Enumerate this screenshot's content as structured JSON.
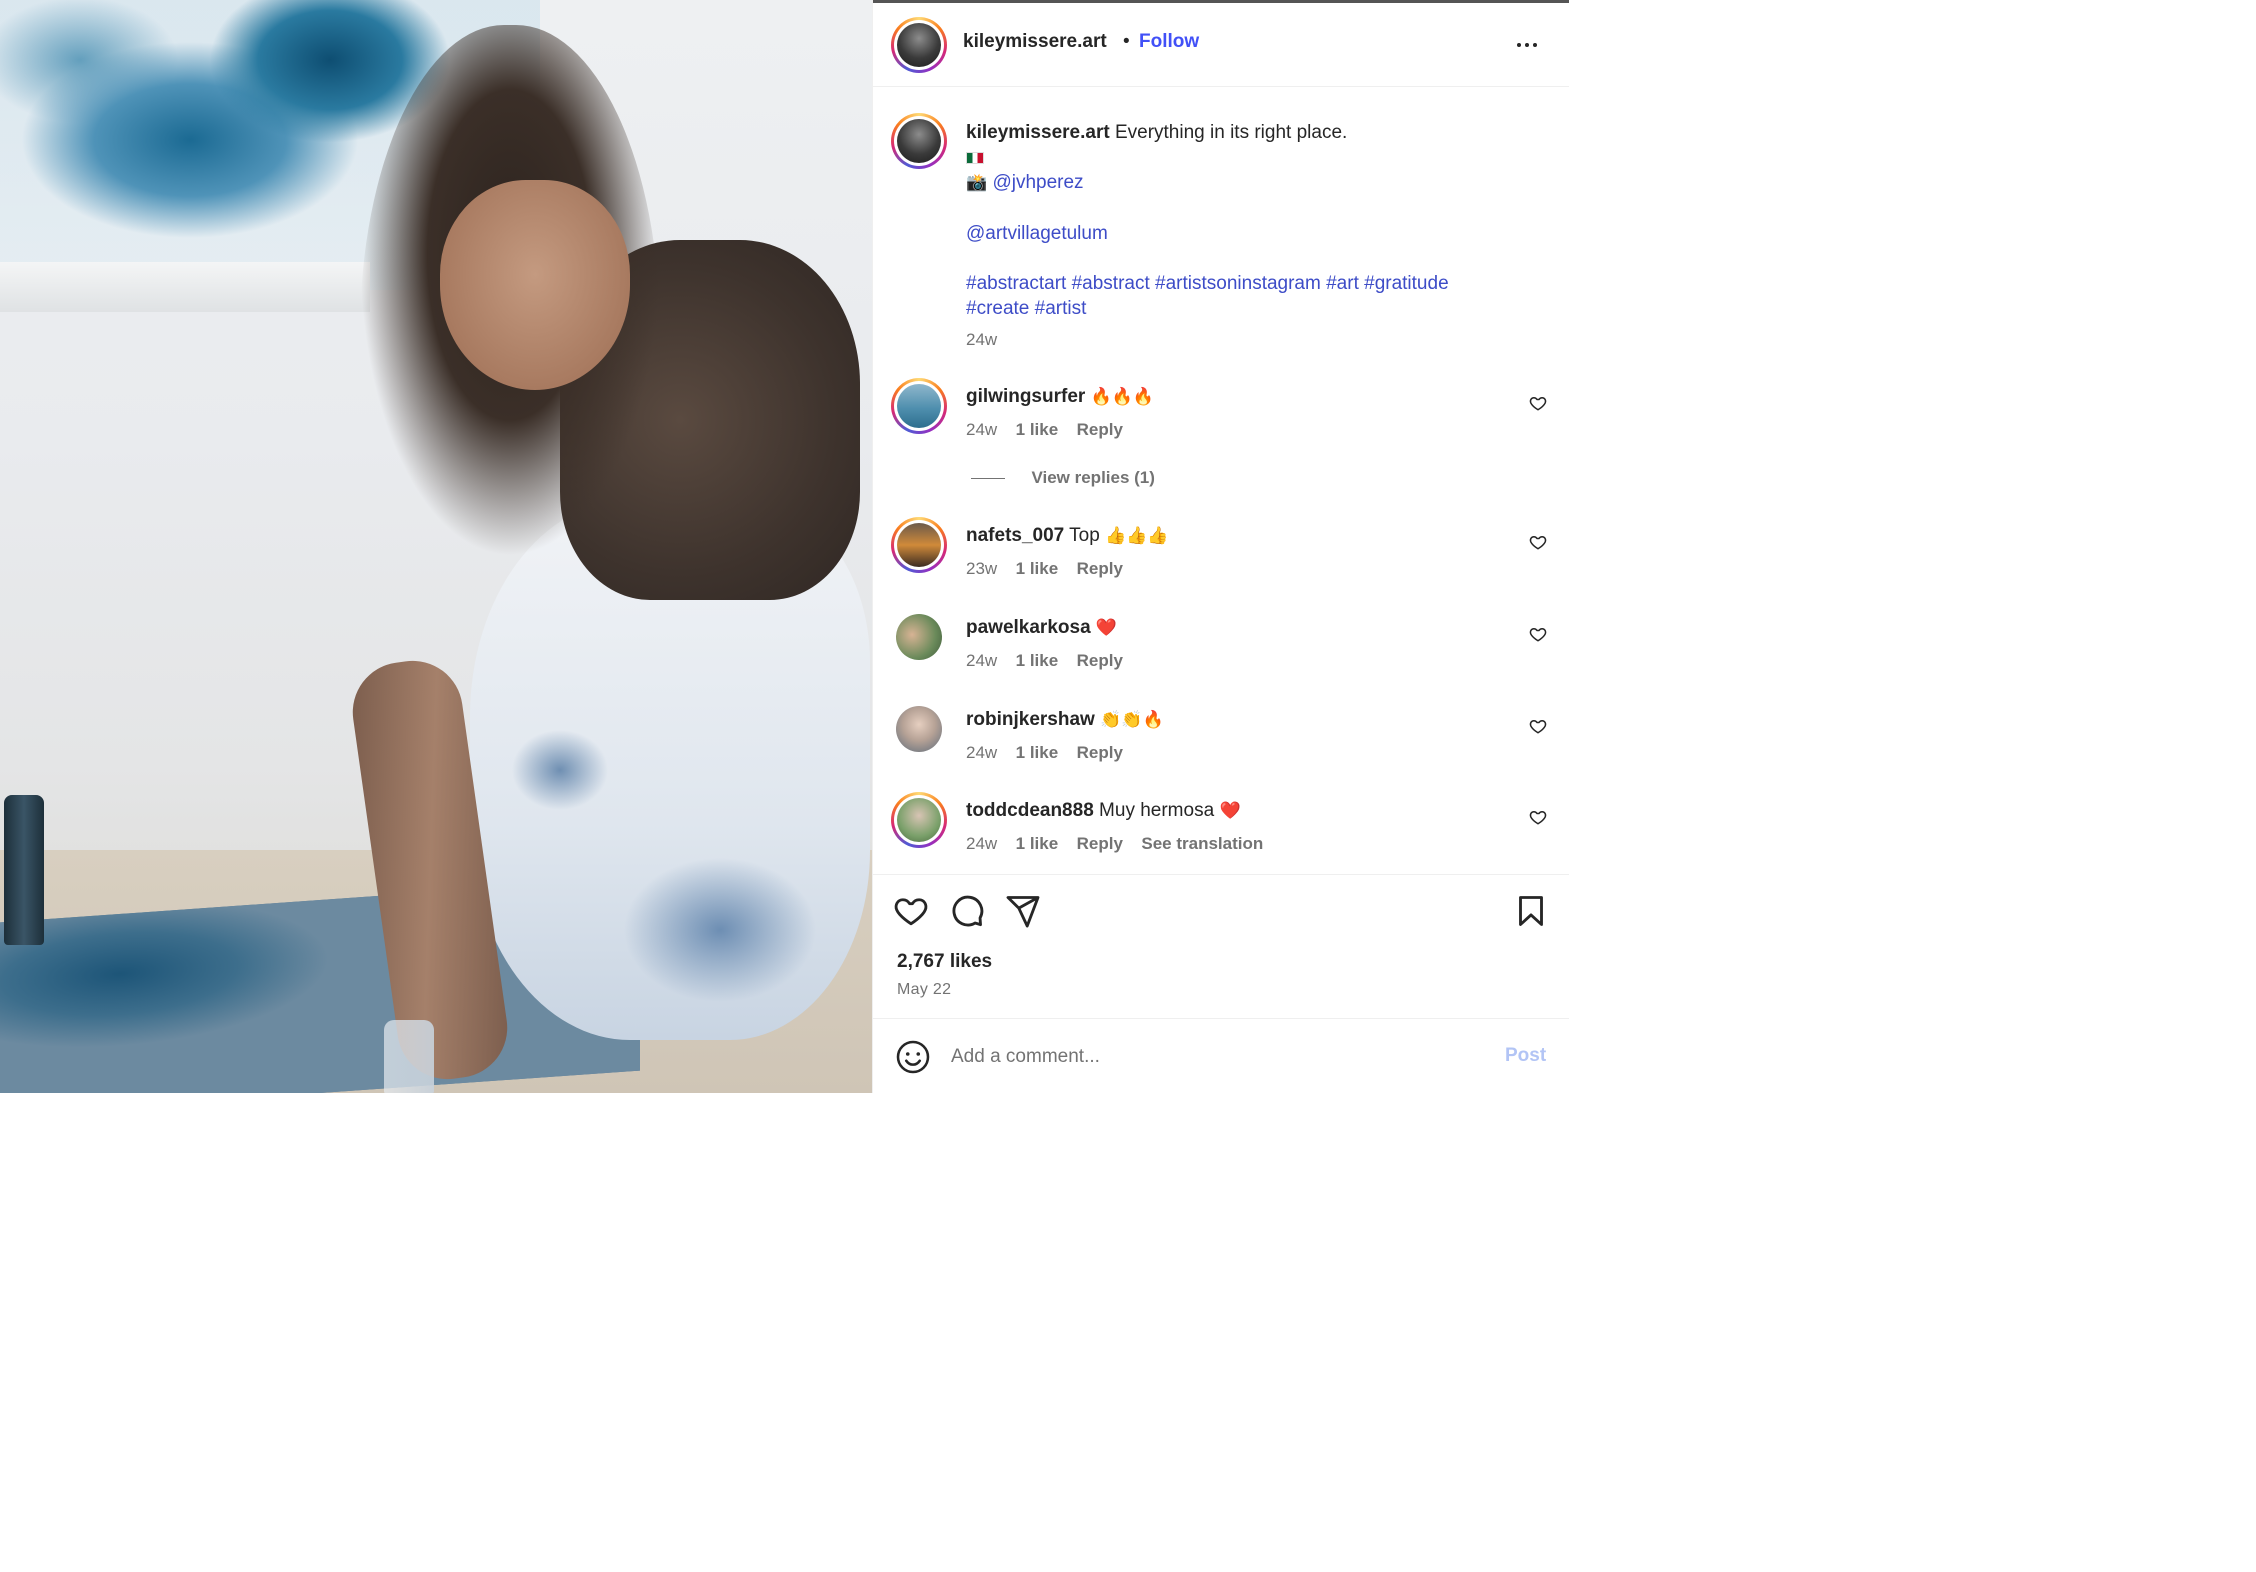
{
  "post": {
    "username": "kileymissere.art",
    "follow_label": "Follow",
    "separator": "•",
    "caption": {
      "username": "kileymissere.art",
      "text": "Everything in its right place.",
      "flag_alt": "🇲🇽",
      "camera_emoji": "📸",
      "photographer": "@jvhperez",
      "location_tag": "@artvillagetulum",
      "hashtags_line1": "#abstractart #abstract #artistsoninstagram #art #gratitude",
      "hashtags_line2": "#create #artist",
      "time": "24w"
    },
    "comments": [
      {
        "username": "gilwingsurfer",
        "text": "",
        "emoji": "🔥🔥🔥",
        "time": "24w",
        "likes": "1 like",
        "reply": "Reply",
        "extra": ""
      },
      {
        "username": "nafets_007",
        "text": "Top",
        "emoji": "👍👍👍",
        "time": "23w",
        "likes": "1 like",
        "reply": "Reply",
        "extra": ""
      },
      {
        "username": "pawelkarkosa",
        "text": "",
        "emoji": "❤️",
        "time": "24w",
        "likes": "1 like",
        "reply": "Reply",
        "extra": ""
      },
      {
        "username": "robinjkershaw",
        "text": "",
        "emoji": "👏👏🔥",
        "time": "24w",
        "likes": "1 like",
        "reply": "Reply",
        "extra": ""
      },
      {
        "username": "toddcdean888",
        "text": "Muy hermosa",
        "emoji": "❤️",
        "time": "24w",
        "likes": "1 like",
        "reply": "Reply",
        "extra": "See translation"
      }
    ],
    "view_replies": "View replies (1)",
    "likes_count": "2,767 likes",
    "date": "May 22",
    "add_comment_placeholder": "Add a comment...",
    "post_label": "Post",
    "icons": {
      "more": "more-horizontal-icon",
      "like": "heart-icon",
      "comment": "comment-icon",
      "share": "paper-plane-icon",
      "save": "bookmark-icon",
      "emoji": "smiley-icon"
    },
    "colors": {
      "link": "#3d4cc7",
      "follow": "#4150f7",
      "post_disabled": "#b2c4f5",
      "secondary_text": "#737373"
    }
  }
}
